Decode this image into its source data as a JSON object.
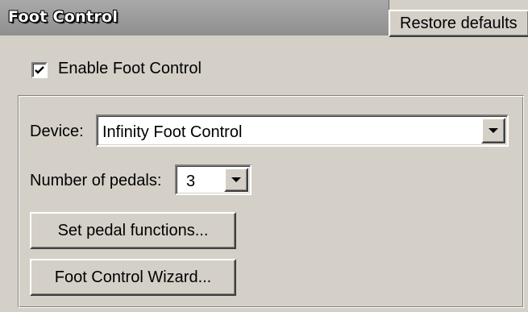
{
  "header": {
    "title": "Foot Control",
    "restore_label": "Restore defaults"
  },
  "enable_checkbox": {
    "label": "Enable Foot Control",
    "checked": true
  },
  "device": {
    "label": "Device:",
    "value": "Infinity Foot Control"
  },
  "pedals": {
    "label": "Number of pedals:",
    "value": "3"
  },
  "buttons": {
    "set_pedal_functions": "Set pedal functions...",
    "wizard": "Foot Control Wizard..."
  },
  "colors": {
    "face": "#d4d0c8",
    "header": "#8f8f8f"
  },
  "icons": {
    "checkmark": "checkmark-icon",
    "dropdown": "chevron-down-icon"
  }
}
